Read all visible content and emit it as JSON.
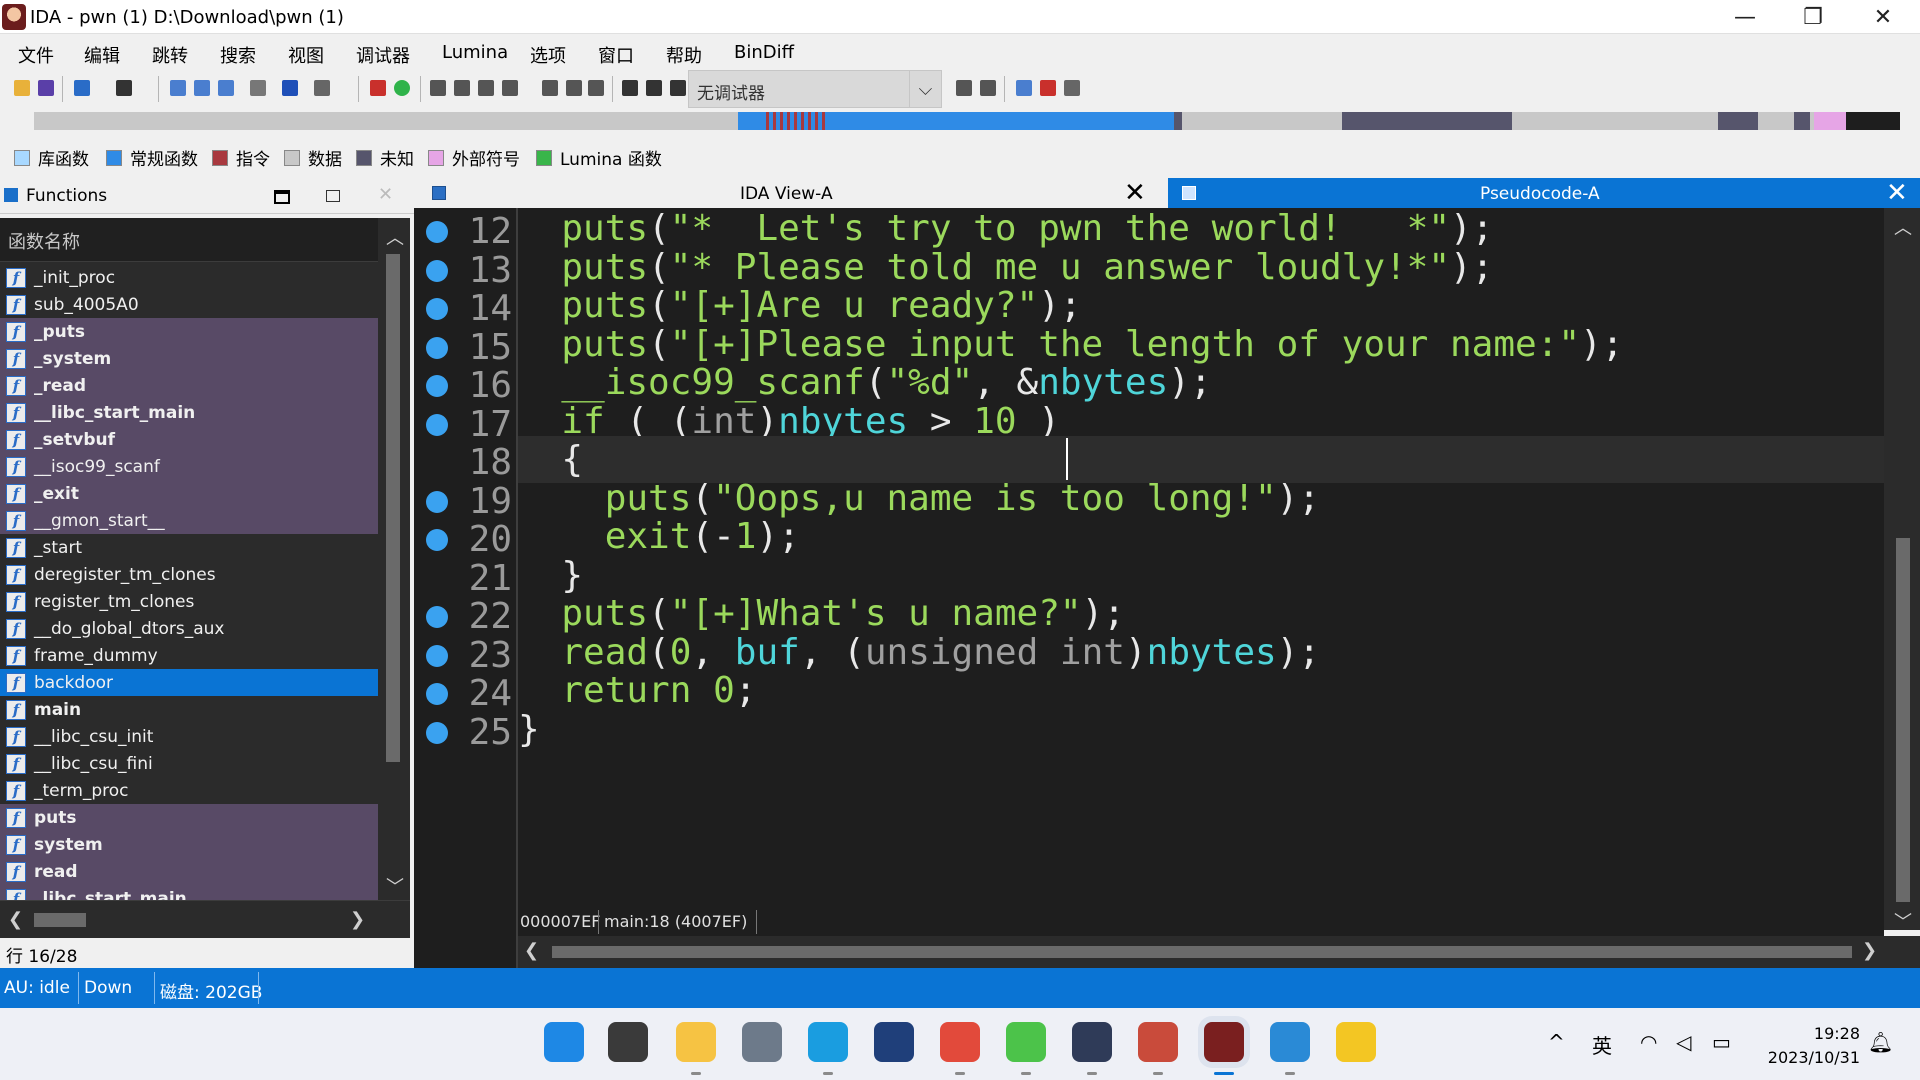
{
  "window": {
    "title": "IDA - pwn (1) D:\\Download\\pwn (1)",
    "minimize": "—",
    "maximize": "❐",
    "close": "✕"
  },
  "menu": [
    "文件",
    "编辑",
    "跳转",
    "搜索",
    "视图",
    "调试器",
    "Lumina",
    "选项",
    "窗口",
    "帮助",
    "BinDiff"
  ],
  "toolbar": {
    "debugger_select": "无调试器",
    "debugger_arrow": "⌵"
  },
  "legend": [
    {
      "label": "库函数",
      "color": "#a8d8ff"
    },
    {
      "label": "常规函数",
      "color": "#2f8be6"
    },
    {
      "label": "指令",
      "color": "#a8393f"
    },
    {
      "label": "数据",
      "color": "#c8c8c8"
    },
    {
      "label": "未知",
      "color": "#56556c"
    },
    {
      "label": "外部符号",
      "color": "#e6a5e6"
    },
    {
      "label": "Lumina 函数",
      "color": "#39b54a"
    }
  ],
  "functions_panel": {
    "title": "Functions",
    "close": "✕",
    "column_header": "函数名称",
    "row_count": "行 16/28",
    "icon_glyph": "f",
    "scroll_up": "︿",
    "scroll_down": "﹀",
    "scroll_left": "❮",
    "scroll_right": "❯",
    "items": [
      {
        "name": "_init_proc",
        "kind": "normal",
        "bold": false
      },
      {
        "name": "sub_4005A0",
        "kind": "normal",
        "bold": false
      },
      {
        "name": "_puts",
        "kind": "ext",
        "bold": true
      },
      {
        "name": "_system",
        "kind": "ext",
        "bold": true
      },
      {
        "name": "_read",
        "kind": "ext",
        "bold": true
      },
      {
        "name": "__libc_start_main",
        "kind": "ext",
        "bold": true
      },
      {
        "name": "_setvbuf",
        "kind": "ext",
        "bold": true
      },
      {
        "name": "__isoc99_scanf",
        "kind": "ext",
        "bold": false
      },
      {
        "name": "_exit",
        "kind": "ext",
        "bold": true
      },
      {
        "name": "__gmon_start__",
        "kind": "ext",
        "bold": false
      },
      {
        "name": "_start",
        "kind": "normal",
        "bold": false
      },
      {
        "name": "deregister_tm_clones",
        "kind": "normal",
        "bold": false
      },
      {
        "name": "register_tm_clones",
        "kind": "normal",
        "bold": false
      },
      {
        "name": "__do_global_dtors_aux",
        "kind": "normal",
        "bold": false
      },
      {
        "name": "frame_dummy",
        "kind": "normal",
        "bold": false
      },
      {
        "name": "backdoor",
        "kind": "selected",
        "bold": false
      },
      {
        "name": "main",
        "kind": "normal",
        "bold": true
      },
      {
        "name": "__libc_csu_init",
        "kind": "normal",
        "bold": false
      },
      {
        "name": "__libc_csu_fini",
        "kind": "normal",
        "bold": false
      },
      {
        "name": "_term_proc",
        "kind": "normal",
        "bold": false
      },
      {
        "name": "puts",
        "kind": "ext",
        "bold": true
      },
      {
        "name": "system",
        "kind": "ext",
        "bold": true
      },
      {
        "name": "read",
        "kind": "ext",
        "bold": true
      },
      {
        "name": "_libc_start_main",
        "kind": "ext",
        "bold": true
      }
    ]
  },
  "tabs": {
    "ida_view": {
      "label": "IDA View-A",
      "close": "✕"
    },
    "pseudocode": {
      "label": "Pseudocode-A",
      "close": "✕"
    }
  },
  "code": {
    "lines": [
      {
        "num": "12",
        "bp": true,
        "cur": false,
        "tokens": [
          [
            "pun",
            "  "
          ],
          [
            "fn",
            "puts"
          ],
          [
            "pun",
            "("
          ],
          [
            "str",
            "\"*  Let's try to pwn the world!   *\""
          ],
          [
            "pun",
            ");"
          ]
        ]
      },
      {
        "num": "13",
        "bp": true,
        "cur": false,
        "tokens": [
          [
            "pun",
            "  "
          ],
          [
            "fn",
            "puts"
          ],
          [
            "pun",
            "("
          ],
          [
            "str",
            "\"* Please told me u answer loudly!*\""
          ],
          [
            "pun",
            ");"
          ]
        ]
      },
      {
        "num": "14",
        "bp": true,
        "cur": false,
        "tokens": [
          [
            "pun",
            "  "
          ],
          [
            "fn",
            "puts"
          ],
          [
            "pun",
            "("
          ],
          [
            "str",
            "\"[+]Are u ready?\""
          ],
          [
            "pun",
            ");"
          ]
        ]
      },
      {
        "num": "15",
        "bp": true,
        "cur": false,
        "tokens": [
          [
            "pun",
            "  "
          ],
          [
            "fn",
            "puts"
          ],
          [
            "pun",
            "("
          ],
          [
            "str",
            "\"[+]Please input the length of your name:\""
          ],
          [
            "pun",
            ");"
          ]
        ]
      },
      {
        "num": "16",
        "bp": true,
        "cur": false,
        "tokens": [
          [
            "pun",
            "  "
          ],
          [
            "fn",
            "__isoc99_scanf"
          ],
          [
            "pun",
            "("
          ],
          [
            "str",
            "\"%d\""
          ],
          [
            "pun",
            ", &"
          ],
          [
            "var",
            "nbytes"
          ],
          [
            "pun",
            ");"
          ]
        ]
      },
      {
        "num": "17",
        "bp": true,
        "cur": false,
        "tokens": [
          [
            "pun",
            "  "
          ],
          [
            "kw",
            "if"
          ],
          [
            "pun",
            " ( ("
          ],
          [
            "ty",
            "int"
          ],
          [
            "pun",
            ")"
          ],
          [
            "var",
            "nbytes"
          ],
          [
            "pun",
            " > "
          ],
          [
            "num",
            "10"
          ],
          [
            "pun",
            " )"
          ]
        ]
      },
      {
        "num": "18",
        "bp": false,
        "cur": true,
        "tokens": [
          [
            "pun",
            "  {"
          ]
        ]
      },
      {
        "num": "19",
        "bp": true,
        "cur": false,
        "tokens": [
          [
            "pun",
            "    "
          ],
          [
            "fn",
            "puts"
          ],
          [
            "pun",
            "("
          ],
          [
            "str",
            "\"Oops,u name is too long!\""
          ],
          [
            "pun",
            ");"
          ]
        ]
      },
      {
        "num": "20",
        "bp": true,
        "cur": false,
        "tokens": [
          [
            "pun",
            "    "
          ],
          [
            "fn",
            "exit"
          ],
          [
            "pun",
            "(-"
          ],
          [
            "num",
            "1"
          ],
          [
            "pun",
            ");"
          ]
        ]
      },
      {
        "num": "21",
        "bp": false,
        "cur": false,
        "tokens": [
          [
            "pun",
            "  }"
          ]
        ]
      },
      {
        "num": "22",
        "bp": true,
        "cur": false,
        "tokens": [
          [
            "pun",
            "  "
          ],
          [
            "fn",
            "puts"
          ],
          [
            "pun",
            "("
          ],
          [
            "str",
            "\"[+]What's u name?\""
          ],
          [
            "pun",
            ");"
          ]
        ]
      },
      {
        "num": "23",
        "bp": true,
        "cur": false,
        "tokens": [
          [
            "pun",
            "  "
          ],
          [
            "fn",
            "read"
          ],
          [
            "pun",
            "("
          ],
          [
            "num",
            "0"
          ],
          [
            "pun",
            ", "
          ],
          [
            "var",
            "buf"
          ],
          [
            "pun",
            ", ("
          ],
          [
            "ty",
            "unsigned int"
          ],
          [
            "pun",
            ")"
          ],
          [
            "var",
            "nbytes"
          ],
          [
            "pun",
            ");"
          ]
        ]
      },
      {
        "num": "24",
        "bp": true,
        "cur": false,
        "tokens": [
          [
            "pun",
            "  "
          ],
          [
            "kw",
            "return"
          ],
          [
            "pun",
            " "
          ],
          [
            "num",
            "0"
          ],
          [
            "pun",
            ";"
          ]
        ]
      },
      {
        "num": "25",
        "bp": true,
        "cur": false,
        "tokens": [
          [
            "pun",
            "}"
          ]
        ]
      }
    ],
    "status_addr": "000007EF",
    "status_loc": "main:18 (4007EF)"
  },
  "statusbar": {
    "au": "AU:  idle",
    "direction": "Down",
    "disk": "磁盘: 202GB"
  },
  "taskbar": {
    "icons": [
      {
        "name": "windows-start-icon",
        "color": "#1e88e5"
      },
      {
        "name": "task-view-icon",
        "color": "#3a3a3a"
      },
      {
        "name": "file-explorer-icon",
        "color": "#f6c343"
      },
      {
        "name": "settings-icon",
        "color": "#6d7a8a"
      },
      {
        "name": "edge-icon",
        "color": "#1a9de0"
      },
      {
        "name": "devcpp-icon",
        "color": "#1f3f7a"
      },
      {
        "name": "chrome-icon",
        "color": "#e24a3b"
      },
      {
        "name": "wechat-icon",
        "color": "#4cc34a"
      },
      {
        "name": "cat-app-icon",
        "color": "#2f3b58"
      },
      {
        "name": "avatar-app-icon",
        "color": "#c94b3b"
      },
      {
        "name": "ida-app-icon",
        "color": "#7a1f1f"
      },
      {
        "name": "vm-app-icon",
        "color": "#2a8ad6"
      },
      {
        "name": "lightning-app-icon",
        "color": "#f3c623"
      }
    ],
    "tray_chevron": "^",
    "ime": "英",
    "time": "19:28",
    "date": "2023/10/31"
  }
}
